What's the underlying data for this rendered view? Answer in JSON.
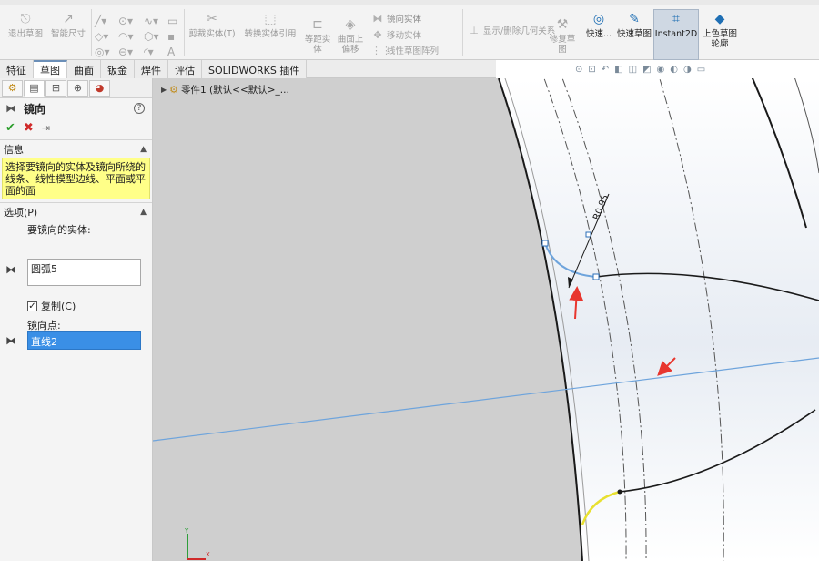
{
  "ribbon": {
    "exit_sketch": "退出草图",
    "smart_dimension": "智能尺寸",
    "trim_entities": "剪裁实体(T)",
    "convert_entities": "转换实体引用",
    "offset_entities": "等距实体",
    "offset_on_surface": "曲面上偏移",
    "mirror_entities": "镜向实体",
    "move_entities": "移动实体",
    "linear_pattern": "线性草图阵列",
    "display_relations": "显示/删除几何关系",
    "repair_sketch": "修复草图",
    "quick_snaps": "快速...",
    "rapid_sketch": "快速草图",
    "instant2d": "Instant2D",
    "shaded_sketch": "上色草图轮廓"
  },
  "tabs": [
    "特征",
    "草图",
    "曲面",
    "钣金",
    "焊件",
    "评估",
    "SOLIDWORKS 插件"
  ],
  "active_tab": "草图",
  "property_manager": {
    "title": "镜向",
    "help": "?",
    "info_header": "信息",
    "info_text": "选择要镜向的实体及镜向所绕的线条、线性模型边线、平面或平面的面",
    "options_header": "选项(P)",
    "entities_label": "要镜向的实体:",
    "entities_value": "圆弧5",
    "copy_label": "复制(C)",
    "copy_checked": "✓",
    "mirror_about_label": "镜向点:",
    "mirror_about_value": "直线2"
  },
  "tree": {
    "part_label": "零件1 (默认<<默认>_..."
  },
  "sketch": {
    "dimension_text": "R0.95"
  },
  "colors": {
    "annotation_arrow": "#e8362e",
    "selected_arc": "#6ea4dc",
    "centerline": "#6ea4dc",
    "highlight_arc": "#e8e030"
  }
}
